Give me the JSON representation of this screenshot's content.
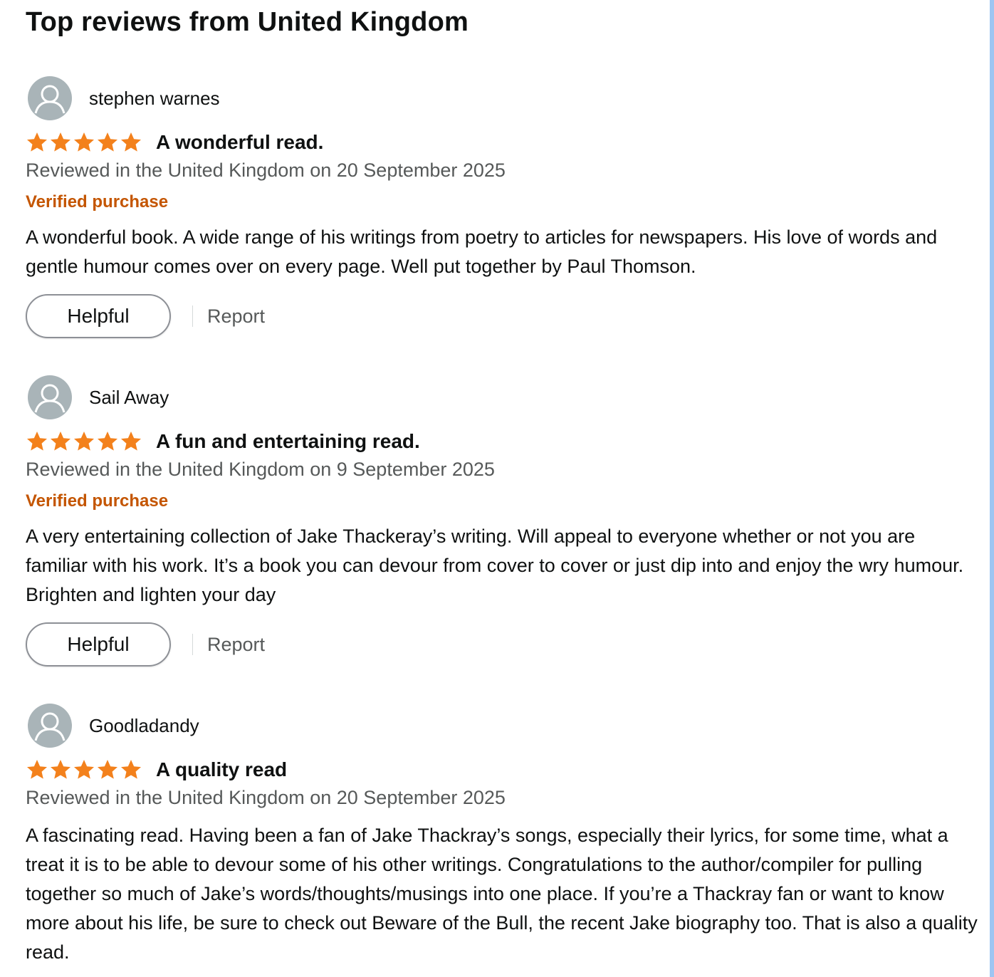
{
  "section": {
    "title": "Top reviews from United Kingdom"
  },
  "colors": {
    "star": "#f3811c",
    "verified": "#c45500",
    "meta": "#565959",
    "avatar_bg": "#a9b4b8"
  },
  "reviews": [
    {
      "reviewer": "stephen warnes",
      "rating": 5,
      "rating_max": 5,
      "title": "A wonderful read.",
      "date_line": "Reviewed in the United Kingdom on 20 September 2025",
      "verified_label": "Verified purchase",
      "body": "A wonderful book. A wide range of his writings from poetry to articles for newspapers. His love of words and gentle humour comes over on every page. Well put together by Paul Thomson.",
      "helpful_label": "Helpful",
      "report_label": "Report"
    },
    {
      "reviewer": "Sail Away",
      "rating": 5,
      "rating_max": 5,
      "title": "A fun and entertaining read.",
      "date_line": "Reviewed in the United Kingdom on 9 September 2025",
      "verified_label": "Verified purchase",
      "body": "A very entertaining collection of Jake Thackeray’s writing. Will appeal to everyone whether or not you are familiar with his work. It’s a book you can devour from cover to cover or just dip into and enjoy the wry humour. Brighten and lighten your day",
      "helpful_label": "Helpful",
      "report_label": "Report"
    },
    {
      "reviewer": "Goodladandy",
      "rating": 5,
      "rating_max": 5,
      "title": "A quality read",
      "date_line": "Reviewed in the United Kingdom on 20 September 2025",
      "body": "A fascinating read. Having been a fan of Jake Thackray’s songs, especially their lyrics, for some time, what a treat it is to be able to devour some of his other writings. Congratulations to the author/compiler for pulling together so much of Jake’s words/thoughts/musings into one place. If you’re a Thackray fan or want to know more about his life, be sure to check out Beware of the Bull, the recent Jake biography too. That is also a quality read."
    }
  ]
}
